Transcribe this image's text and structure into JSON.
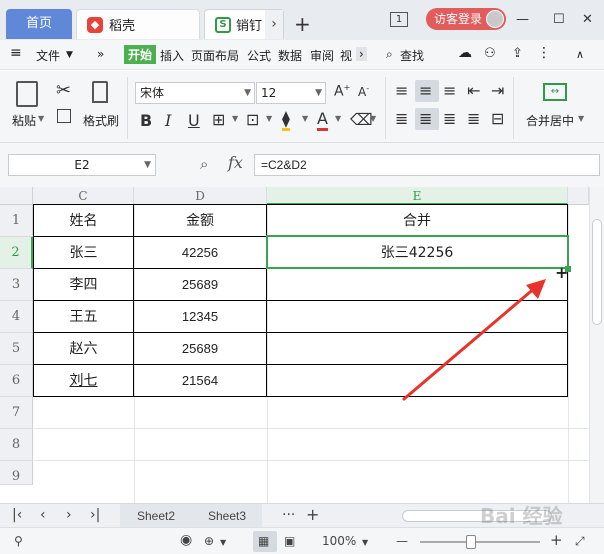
{
  "tabs": {
    "home": "首页",
    "doc1": "稻壳",
    "doc2": "销钉",
    "login": "访客登录"
  },
  "menu": {
    "file": "文件",
    "start": "开始",
    "insert": "插入",
    "layout": "页面布局",
    "formula": "公式",
    "data": "数据",
    "review": "审阅",
    "view": "视",
    "search": "查找"
  },
  "ribbon": {
    "paste": "粘贴",
    "format_painter": "格式刷",
    "font_name": "宋体",
    "font_size": "12",
    "merge_center": "合并居中"
  },
  "formula_bar": {
    "name_box": "E2",
    "fx": "fx",
    "formula": "=C2&D2"
  },
  "grid": {
    "columns": [
      "C",
      "D",
      "E"
    ],
    "rows": [
      "1",
      "2",
      "3",
      "4",
      "5",
      "6",
      "7",
      "8",
      "9"
    ],
    "header": [
      "姓名",
      "金额",
      "合并"
    ],
    "data": [
      {
        "name": "张三",
        "amount": "42256",
        "merged": "张三42256"
      },
      {
        "name": "李四",
        "amount": "25689",
        "merged": ""
      },
      {
        "name": "王五",
        "amount": "12345",
        "merged": ""
      },
      {
        "name": "赵六",
        "amount": "25689",
        "merged": ""
      },
      {
        "name": "刘七",
        "amount": "21564",
        "merged": ""
      }
    ]
  },
  "sheets": [
    "Sheet2",
    "Sheet3"
  ],
  "status": {
    "zoom": "100%"
  },
  "watermark": "Bai 经验",
  "colors": {
    "accent_green": "#3aa551",
    "home_tab": "#5f89d8",
    "login_red": "#e25c5c",
    "arrow_red": "#e8322b"
  }
}
